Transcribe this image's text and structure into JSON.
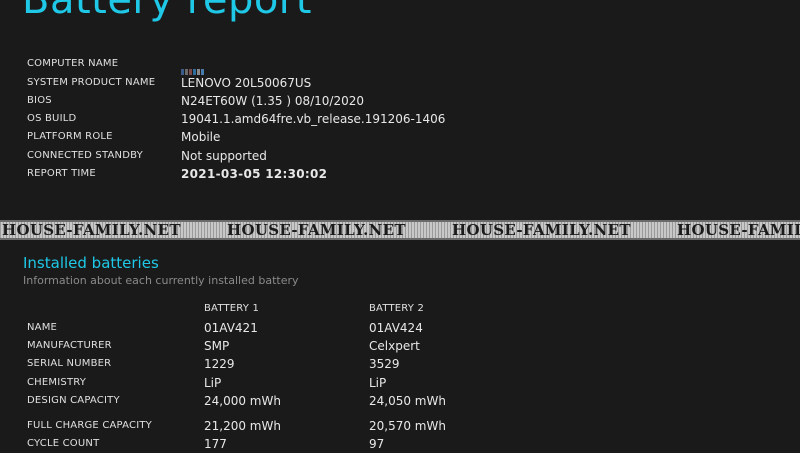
{
  "report": {
    "title": "Battery report"
  },
  "system_info": {
    "rows": [
      {
        "label": "COMPUTER NAME",
        "value": ""
      },
      {
        "label": "SYSTEM PRODUCT NAME",
        "value": "LENOVO 20L50067US"
      },
      {
        "label": "BIOS",
        "value": "N24ET60W (1.35 ) 08/10/2020"
      },
      {
        "label": "OS BUILD",
        "value": "19041.1.amd64fre.vb_release.191206-1406"
      },
      {
        "label": "PLATFORM ROLE",
        "value": "Mobile"
      },
      {
        "label": "CONNECTED STANDBY",
        "value": "Not supported"
      },
      {
        "label": "REPORT TIME",
        "value": "2021-03-05  12:30:02"
      }
    ],
    "computer_name_redacted_colors": [
      "#3a5a8a",
      "#6a6a6a",
      "#7a4a4a",
      "#2f6f9f",
      "#8a8a8a",
      "#4a7aaa"
    ]
  },
  "watermark": {
    "text": "HOUSE-FAMILY.NET"
  },
  "installed_batteries": {
    "heading": "Installed batteries",
    "subheading": "Information about each currently installed battery",
    "columns": [
      "BATTERY 1",
      "BATTERY 2"
    ],
    "rows": [
      {
        "label": "NAME",
        "values": [
          "01AV421",
          "01AV424"
        ]
      },
      {
        "label": "MANUFACTURER",
        "values": [
          "SMP",
          "Celxpert"
        ]
      },
      {
        "label": "SERIAL NUMBER",
        "values": [
          "1229",
          "3529"
        ]
      },
      {
        "label": "CHEMISTRY",
        "values": [
          "LiP",
          "LiP"
        ]
      },
      {
        "label": "DESIGN CAPACITY",
        "values": [
          "24,000 mWh",
          "24,050 mWh"
        ]
      },
      {
        "label": "FULL CHARGE CAPACITY",
        "values": [
          "21,200 mWh",
          "20,570 mWh"
        ]
      },
      {
        "label": "CYCLE COUNT",
        "values": [
          "177",
          "97"
        ]
      }
    ]
  },
  "theme": {
    "background": "#1a1a1a",
    "accent": "#1ec8e6",
    "text": "#e8e8e8",
    "muted": "#8a8a8a"
  }
}
